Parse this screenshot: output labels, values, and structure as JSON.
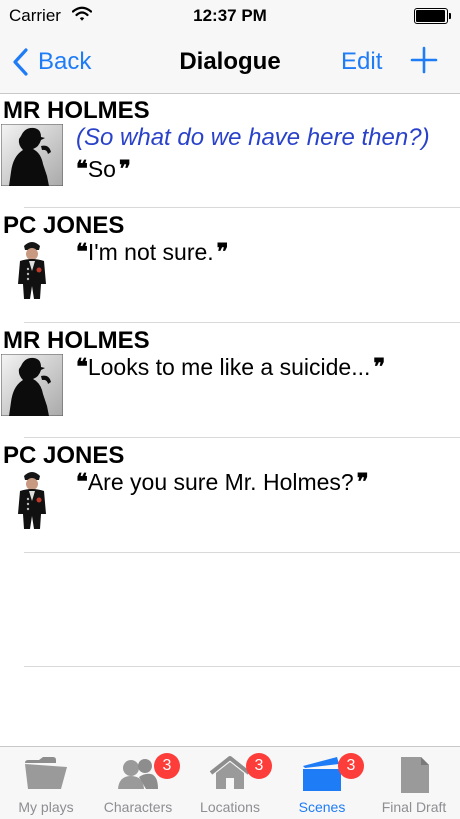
{
  "status": {
    "carrier": "Carrier",
    "time": "12:37 PM"
  },
  "nav": {
    "back_label": "Back",
    "title": "Dialogue",
    "edit_label": "Edit"
  },
  "dialogue": [
    {
      "speaker": "MR HOLMES",
      "direction": "(So what do we have here then?)",
      "text": "So",
      "avatar": "holmes-silhouette"
    },
    {
      "speaker": "PC JONES",
      "direction": "",
      "text": "I'm not sure.",
      "avatar": "police-constable"
    },
    {
      "speaker": "MR HOLMES",
      "direction": "",
      "text": "Looks to me like a suicide...",
      "avatar": "holmes-silhouette"
    },
    {
      "speaker": "PC JONES",
      "direction": "",
      "text": "Are you sure Mr. Holmes?",
      "avatar": "police-constable"
    }
  ],
  "tabs": [
    {
      "label": "My plays",
      "icon": "folder-icon",
      "badge": ""
    },
    {
      "label": "Characters",
      "icon": "people-icon",
      "badge": "3"
    },
    {
      "label": "Locations",
      "icon": "house-icon",
      "badge": "3"
    },
    {
      "label": "Scenes",
      "icon": "clapperboard-icon",
      "badge": "3"
    },
    {
      "label": "Final Draft",
      "icon": "document-icon",
      "badge": ""
    }
  ],
  "colors": {
    "accent": "#1f7cf7",
    "direction_text": "#2942c9",
    "badge": "#fc3d39",
    "inactive": "#8e8e93"
  }
}
